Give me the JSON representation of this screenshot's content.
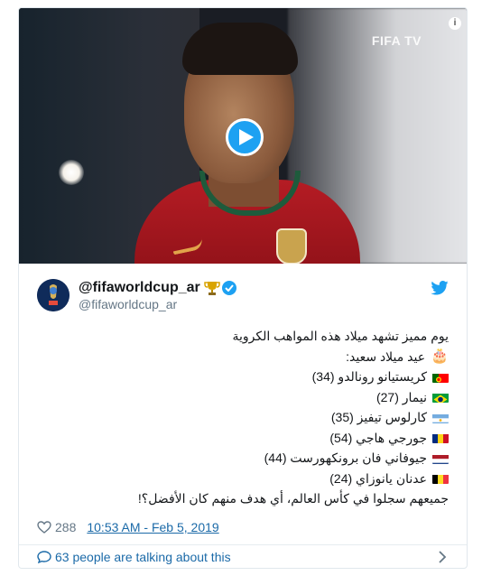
{
  "media": {
    "watermark": "FIFA TV",
    "play_icon": "play-icon",
    "info_icon": "info-icon",
    "info_glyph": "i"
  },
  "account": {
    "display_name": "@fifaworldcup_ar",
    "handle": "@fifaworldcup_ar",
    "badges": [
      "trophy-icon",
      "verified-icon"
    ],
    "brand_icon": "twitter-bird-icon"
  },
  "tweet": {
    "intro": "يوم مميز تشهد ميلاد هذه المواهب الكروية",
    "greeting_emoji": "🎂",
    "greeting": "عيد ميلاد سعيد:",
    "players": [
      {
        "flag": "portugal-flag",
        "text": "كريستيانو رونالدو (34)"
      },
      {
        "flag": "brazil-flag",
        "text": "نيمار (27)"
      },
      {
        "flag": "argentina-flag",
        "text": "كارلوس تيفيز (35)"
      },
      {
        "flag": "romania-flag",
        "text": "جورجي هاجي (54)"
      },
      {
        "flag": "netherlands-flag",
        "text": "جيوفاني فان برونكهورست (44)"
      },
      {
        "flag": "belgium-flag",
        "text": "عدنان يانوزاي (24)"
      }
    ],
    "closing": "جميعهم سجلوا في كأس العالم، أي هدف منهم كان الأفضل؟!"
  },
  "footer": {
    "likes": "288",
    "timestamp": "10:53 AM - Feb 5, 2019",
    "talking": "63 people are talking about this"
  },
  "colors": {
    "accent": "#1da1f2",
    "link": "#1b6aa8",
    "muted": "#657786",
    "border": "#e1e8ed"
  }
}
